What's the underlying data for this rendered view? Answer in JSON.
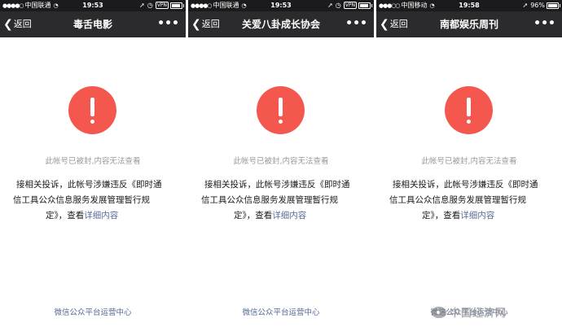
{
  "colors": {
    "status_bar": "#1b1b1d",
    "nav_bar": "#2b2b2d",
    "alert_red": "#f4574d",
    "link_blue": "#586c94",
    "muted_gray": "#9a9a9a"
  },
  "phones": [
    {
      "status": {
        "carrier": "中国联通",
        "time": "19:53",
        "vpn": "VPN",
        "signal_icon": "signal-dots-icon",
        "wifi_icon": "wifi-icon",
        "battery_icon": "battery-icon",
        "battery_level": 0.8
      },
      "nav": {
        "back_label": "返回",
        "title": "毒舌电影",
        "more_label": "•••"
      },
      "content": {
        "icon": "exclamation-icon",
        "banned_text": "此帐号已被封,内容无法查看",
        "desc_line1": "接相关投诉，此帐号涉嫌违反《即时通",
        "desc_line2": "信工具公众信息服务发展管理暂行规",
        "desc_line3_prefix": "定》，查看",
        "detail_link": "详细内容",
        "footer": "微信公众平台运营中心"
      }
    },
    {
      "status": {
        "carrier": "中国联通",
        "time": "19:53",
        "vpn": "VPN",
        "signal_icon": "signal-dots-icon",
        "wifi_icon": "wifi-icon",
        "battery_icon": "battery-icon",
        "battery_level": 0.8
      },
      "nav": {
        "back_label": "返回",
        "title": "关爱八卦成长协会",
        "more_label": "•••"
      },
      "content": {
        "icon": "exclamation-icon",
        "banned_text": "此帐号已被封,内容无法查看",
        "desc_line1": "接相关投诉，此帐号涉嫌违反《即时通",
        "desc_line2": "信工具公众信息服务发展管理暂行规",
        "desc_line3_prefix": "定》，查看",
        "detail_link": "详细内容",
        "footer": "微信公众平台运营中心"
      }
    },
    {
      "status": {
        "carrier": "中国移动",
        "time": "19:58",
        "battery_pct": "96%",
        "signal_icon": "signal-dots-icon",
        "wifi_icon": "wifi-icon",
        "location_icon": "location-arrow-icon",
        "battery_icon": "battery-icon",
        "battery_level": 0.96
      },
      "nav": {
        "back_label": "返回",
        "title": "南都娱乐周刊",
        "more_label": "•••"
      },
      "content": {
        "icon": "exclamation-icon",
        "banned_text": "此帐号已被封,内容无法查看",
        "desc_line1": "接相关投诉，此帐号涉嫌违反《即时通",
        "desc_line2": "信工具公众信息服务发展管理暂行规",
        "desc_line3_prefix": "定》，查看",
        "detail_link": "详细内容",
        "footer": "微信公众平台运营中心"
      }
    }
  ],
  "watermark": {
    "text": "中国经济网"
  }
}
